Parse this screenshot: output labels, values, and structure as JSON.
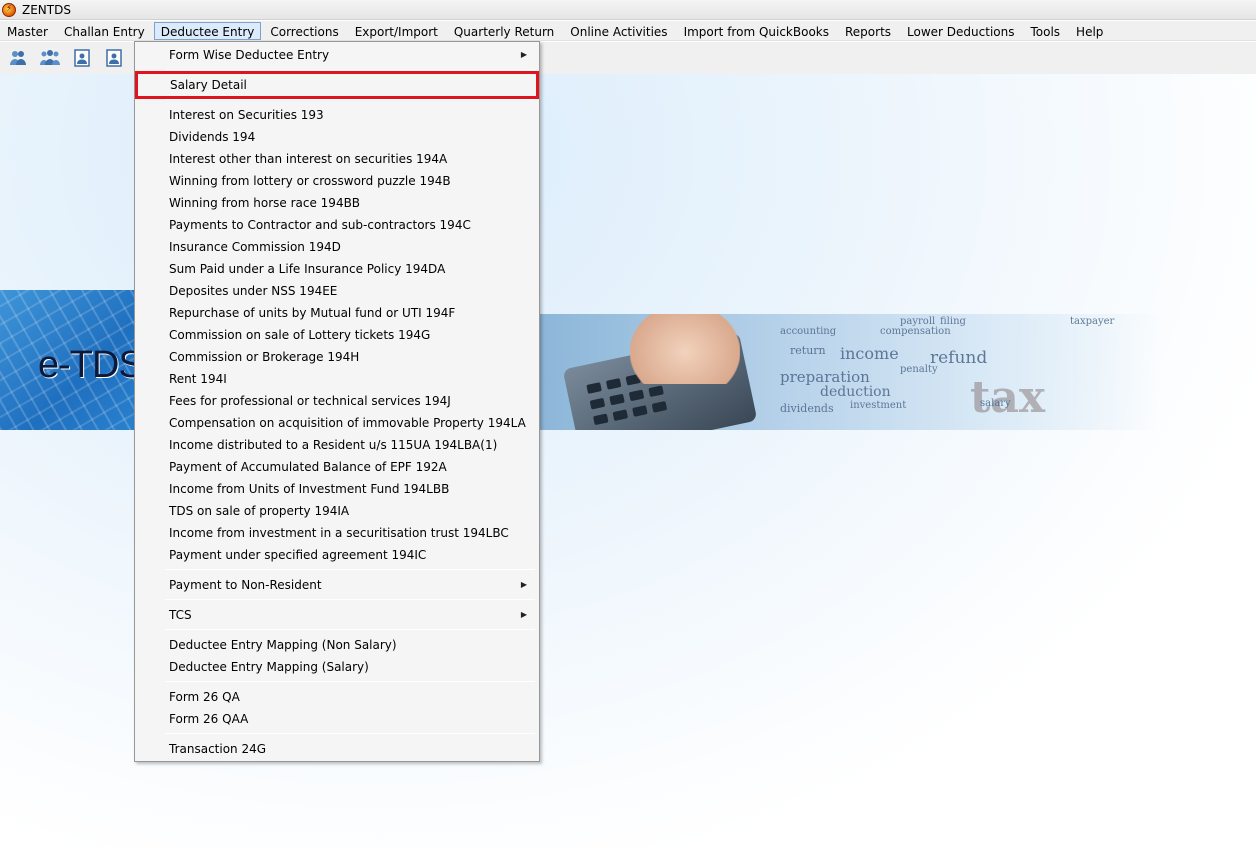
{
  "window": {
    "title": "ZENTDS"
  },
  "menubar": {
    "items": [
      {
        "label": "Master"
      },
      {
        "label": "Challan Entry"
      },
      {
        "label": "Deductee Entry",
        "active": true
      },
      {
        "label": "Corrections"
      },
      {
        "label": "Export/Import"
      },
      {
        "label": "Quarterly Return"
      },
      {
        "label": "Online Activities"
      },
      {
        "label": "Import from QuickBooks"
      },
      {
        "label": "Reports"
      },
      {
        "label": "Lower Deductions"
      },
      {
        "label": "Tools"
      },
      {
        "label": "Help"
      }
    ]
  },
  "toolbar": {
    "icons": [
      "user-pair-icon",
      "user-group-icon",
      "document-user-icon",
      "document-user-icon"
    ]
  },
  "banner": {
    "text": "e-TDS"
  },
  "wordcloud": [
    "income",
    "refund",
    "preparation",
    "deduction",
    "tax",
    "payroll",
    "return",
    "salary",
    "penalty",
    "compensation",
    "dividends",
    "investment",
    "accounting",
    "taxpayer",
    "filing"
  ],
  "dropdown": {
    "groups": [
      [
        {
          "label": "Form Wise Deductee Entry",
          "submenu": true
        }
      ],
      [
        {
          "label": "Salary Detail",
          "highlight": true
        }
      ],
      [
        {
          "label": "Interest on Securities 193"
        },
        {
          "label": "Dividends 194"
        },
        {
          "label": "Interest other than interest on securities 194A"
        },
        {
          "label": "Winning from lottery  or crossword puzzle 194B"
        },
        {
          "label": "Winning from horse race 194BB"
        },
        {
          "label": "Payments to Contractor and sub-contractors 194C"
        },
        {
          "label": "Insurance Commission 194D"
        },
        {
          "label": "Sum Paid under a Life Insurance Policy 194DA"
        },
        {
          "label": "Deposites under NSS 194EE"
        },
        {
          "label": "Repurchase of units by Mutual fund or UTI 194F"
        },
        {
          "label": "Commission on sale of Lottery tickets 194G"
        },
        {
          "label": "Commission or Brokerage 194H"
        },
        {
          "label": "Rent 194I"
        },
        {
          "label": "Fees for professional or technical services 194J"
        },
        {
          "label": "Compensation on acquisition of immovable Property 194LA"
        },
        {
          "label": "Income distributed to a Resident u/s 115UA 194LBA(1)"
        },
        {
          "label": "Payment of Accumulated Balance of EPF 192A"
        },
        {
          "label": "Income from Units of Investment Fund 194LBB"
        },
        {
          "label": "TDS on sale of property 194IA"
        },
        {
          "label": "Income from investment in a securitisation trust 194LBC"
        },
        {
          "label": "Payment under specified agreement 194IC"
        }
      ],
      [
        {
          "label": "Payment to Non-Resident",
          "submenu": true
        }
      ],
      [
        {
          "label": "TCS",
          "submenu": true
        }
      ],
      [
        {
          "label": "Deductee Entry Mapping (Non Salary)"
        },
        {
          "label": "Deductee Entry Mapping (Salary)"
        }
      ],
      [
        {
          "label": "Form 26 QA"
        },
        {
          "label": "Form 26 QAA"
        }
      ],
      [
        {
          "label": "Transaction 24G"
        }
      ]
    ]
  },
  "colors": {
    "highlight_border": "#e0141e",
    "menu_active_bg": "#dcebfc",
    "banner_blue": "#1f6fbf"
  }
}
